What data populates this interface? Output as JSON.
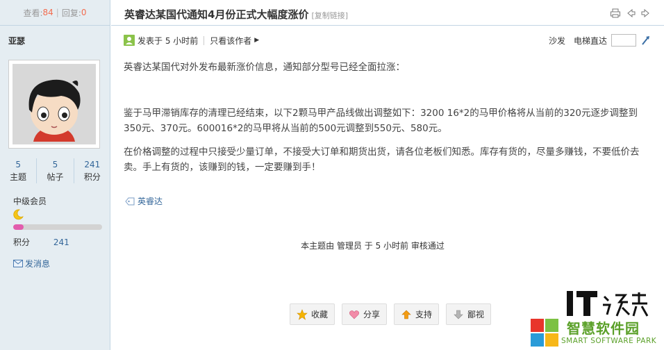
{
  "stats": {
    "view_label": "查看:",
    "views": "84",
    "sep": "|",
    "reply_label": "回复:",
    "replies": "0"
  },
  "author": {
    "name": "亚瑟",
    "topics": "5",
    "topics_label": "主题",
    "posts": "5",
    "posts_label": "帖子",
    "credits": "241",
    "credits_label": "积分",
    "level": "中级会员",
    "level_progress": 0.12,
    "credit_label": "积分",
    "credit_value": "241",
    "send_msg": "发消息"
  },
  "thread": {
    "title": "英睿达某国代通知4月份正式大幅度涨价",
    "copy_link": "[复制链接]",
    "posted": "发表于 5 小时前",
    "only_author": "只看该作者",
    "sofa": "沙发",
    "jump_label": "电梯直达",
    "paragraphs": [
      "英睿达某国代对外发布最新涨价信息，通知部分型号已经全面拉涨：",
      "鉴于马甲滞销库存的清理已经结束，以下2颗马甲产品线做出调整如下：3200 16*2的马甲价格将从当前的320元逐步调整到350元、370元。600016*2的马甲将从当前的500元调整到550元、580元。",
      "在价格调整的过程中只接受少量订单，不接受大订单和期货出货，请各位老板们知悉。库存有货的，尽量多赚钱，不要低价去卖。手上有货的，该赚到的钱，一定要赚到手！"
    ],
    "tag": "英睿达",
    "audit": "本主题由 管理员 于 5 小时前 审核通过"
  },
  "actions": {
    "favorite": "收藏",
    "share": "分享",
    "support": "支持",
    "oppose": "鄙视"
  },
  "watermark": {
    "logo_text": "IT之家",
    "cn": "智慧软件园",
    "en": "SMART SOFTWARE PARK"
  },
  "colors": {
    "sidebar_bg": "#e5edf2",
    "border": "#c2d5e3",
    "link": "#336699",
    "accent": "#f26c4f",
    "watermark": "#5aa028"
  }
}
